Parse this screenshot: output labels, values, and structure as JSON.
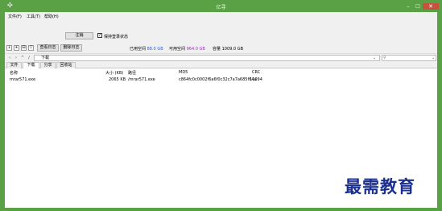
{
  "window": {
    "title": "亿寻",
    "min_label": "–",
    "max_label": "□",
    "close_label": "✕"
  },
  "menubar": {
    "items": [
      "文件(F)",
      "工具(T)",
      "帮助(H)"
    ]
  },
  "options": {
    "system_button": "注销",
    "remember_checked": true,
    "remember_mark": "✓",
    "remember_label": "保持登录状态"
  },
  "toolbar": {
    "icons": [
      "↓",
      "+",
      "⊟",
      "▽"
    ],
    "view_log": "查看日志",
    "clear_log": "删除日志",
    "used_label": "已用空间",
    "used_value": "88.0 GB",
    "available_label": "可用空间",
    "available_value": "964.0 GB",
    "total_label": "容量",
    "total_value": "1009.0 GB"
  },
  "pathbar": {
    "back": "‹",
    "forward": "›",
    "up": "^",
    "path": "下载",
    "dropdown": "⌄",
    "search_value": ""
  },
  "tabs": [
    "文件",
    "下载",
    "分享",
    "回收站"
  ],
  "active_tab": "下载",
  "table": {
    "columns": [
      "名称",
      "大小 (KB)",
      "路径",
      "MD5",
      "CRC"
    ],
    "rows": [
      {
        "name": "mrar571.exe",
        "size": "2065 KB",
        "path": "/mrar571.exe",
        "md5": "c864fc0c0002f6a6f0c32c7a7a685f64a",
        "crc": "11094"
      }
    ]
  },
  "watermark": "最需教育"
}
